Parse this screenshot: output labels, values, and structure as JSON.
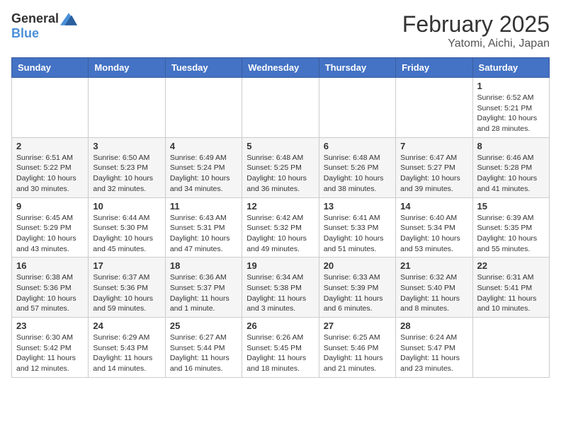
{
  "header": {
    "logo_general": "General",
    "logo_blue": "Blue",
    "month": "February 2025",
    "location": "Yatomi, Aichi, Japan"
  },
  "weekdays": [
    "Sunday",
    "Monday",
    "Tuesday",
    "Wednesday",
    "Thursday",
    "Friday",
    "Saturday"
  ],
  "weeks": [
    [
      {
        "day": "",
        "info": ""
      },
      {
        "day": "",
        "info": ""
      },
      {
        "day": "",
        "info": ""
      },
      {
        "day": "",
        "info": ""
      },
      {
        "day": "",
        "info": ""
      },
      {
        "day": "",
        "info": ""
      },
      {
        "day": "1",
        "info": "Sunrise: 6:52 AM\nSunset: 5:21 PM\nDaylight: 10 hours and 28 minutes."
      }
    ],
    [
      {
        "day": "2",
        "info": "Sunrise: 6:51 AM\nSunset: 5:22 PM\nDaylight: 10 hours and 30 minutes."
      },
      {
        "day": "3",
        "info": "Sunrise: 6:50 AM\nSunset: 5:23 PM\nDaylight: 10 hours and 32 minutes."
      },
      {
        "day": "4",
        "info": "Sunrise: 6:49 AM\nSunset: 5:24 PM\nDaylight: 10 hours and 34 minutes."
      },
      {
        "day": "5",
        "info": "Sunrise: 6:48 AM\nSunset: 5:25 PM\nDaylight: 10 hours and 36 minutes."
      },
      {
        "day": "6",
        "info": "Sunrise: 6:48 AM\nSunset: 5:26 PM\nDaylight: 10 hours and 38 minutes."
      },
      {
        "day": "7",
        "info": "Sunrise: 6:47 AM\nSunset: 5:27 PM\nDaylight: 10 hours and 39 minutes."
      },
      {
        "day": "8",
        "info": "Sunrise: 6:46 AM\nSunset: 5:28 PM\nDaylight: 10 hours and 41 minutes."
      }
    ],
    [
      {
        "day": "9",
        "info": "Sunrise: 6:45 AM\nSunset: 5:29 PM\nDaylight: 10 hours and 43 minutes."
      },
      {
        "day": "10",
        "info": "Sunrise: 6:44 AM\nSunset: 5:30 PM\nDaylight: 10 hours and 45 minutes."
      },
      {
        "day": "11",
        "info": "Sunrise: 6:43 AM\nSunset: 5:31 PM\nDaylight: 10 hours and 47 minutes."
      },
      {
        "day": "12",
        "info": "Sunrise: 6:42 AM\nSunset: 5:32 PM\nDaylight: 10 hours and 49 minutes."
      },
      {
        "day": "13",
        "info": "Sunrise: 6:41 AM\nSunset: 5:33 PM\nDaylight: 10 hours and 51 minutes."
      },
      {
        "day": "14",
        "info": "Sunrise: 6:40 AM\nSunset: 5:34 PM\nDaylight: 10 hours and 53 minutes."
      },
      {
        "day": "15",
        "info": "Sunrise: 6:39 AM\nSunset: 5:35 PM\nDaylight: 10 hours and 55 minutes."
      }
    ],
    [
      {
        "day": "16",
        "info": "Sunrise: 6:38 AM\nSunset: 5:36 PM\nDaylight: 10 hours and 57 minutes."
      },
      {
        "day": "17",
        "info": "Sunrise: 6:37 AM\nSunset: 5:36 PM\nDaylight: 10 hours and 59 minutes."
      },
      {
        "day": "18",
        "info": "Sunrise: 6:36 AM\nSunset: 5:37 PM\nDaylight: 11 hours and 1 minute."
      },
      {
        "day": "19",
        "info": "Sunrise: 6:34 AM\nSunset: 5:38 PM\nDaylight: 11 hours and 3 minutes."
      },
      {
        "day": "20",
        "info": "Sunrise: 6:33 AM\nSunset: 5:39 PM\nDaylight: 11 hours and 6 minutes."
      },
      {
        "day": "21",
        "info": "Sunrise: 6:32 AM\nSunset: 5:40 PM\nDaylight: 11 hours and 8 minutes."
      },
      {
        "day": "22",
        "info": "Sunrise: 6:31 AM\nSunset: 5:41 PM\nDaylight: 11 hours and 10 minutes."
      }
    ],
    [
      {
        "day": "23",
        "info": "Sunrise: 6:30 AM\nSunset: 5:42 PM\nDaylight: 11 hours and 12 minutes."
      },
      {
        "day": "24",
        "info": "Sunrise: 6:29 AM\nSunset: 5:43 PM\nDaylight: 11 hours and 14 minutes."
      },
      {
        "day": "25",
        "info": "Sunrise: 6:27 AM\nSunset: 5:44 PM\nDaylight: 11 hours and 16 minutes."
      },
      {
        "day": "26",
        "info": "Sunrise: 6:26 AM\nSunset: 5:45 PM\nDaylight: 11 hours and 18 minutes."
      },
      {
        "day": "27",
        "info": "Sunrise: 6:25 AM\nSunset: 5:46 PM\nDaylight: 11 hours and 21 minutes."
      },
      {
        "day": "28",
        "info": "Sunrise: 6:24 AM\nSunset: 5:47 PM\nDaylight: 11 hours and 23 minutes."
      },
      {
        "day": "",
        "info": ""
      }
    ]
  ]
}
